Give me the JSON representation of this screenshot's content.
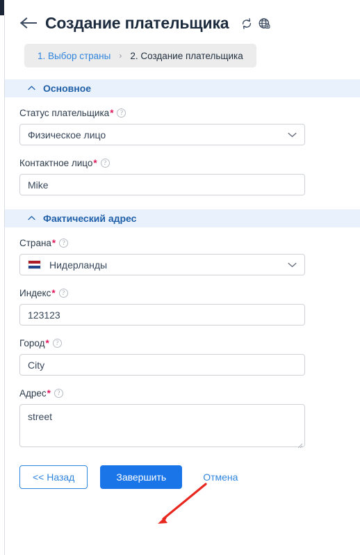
{
  "header": {
    "back_icon": "arrow-left-icon",
    "title": "Создание плательщика",
    "refresh_icon": "refresh-icon",
    "language_icon": "globe-icon"
  },
  "breadcrumb": {
    "steps": [
      {
        "label": "1. Выбор страны",
        "active": false
      },
      {
        "label": "2. Создание плательщика",
        "active": true
      }
    ],
    "separator": "›"
  },
  "sections": [
    {
      "title": "Основное",
      "caret_icon": "chevron-up-icon",
      "fields": [
        {
          "label": "Статус плательщика",
          "required": "*",
          "help": "?",
          "type": "select",
          "value": "Физическое лицо",
          "chevron_icon": "chevron-down-icon"
        },
        {
          "label": "Контактное лицо",
          "required": "*",
          "help": "?",
          "type": "text",
          "value": "Mike"
        }
      ]
    },
    {
      "title": "Фактический адрес",
      "caret_icon": "chevron-up-icon",
      "fields": [
        {
          "label": "Страна",
          "required": "*",
          "help": "?",
          "type": "select-flag",
          "value": "Нидерланды",
          "flag_icon": "flag-netherlands-icon",
          "chevron_icon": "chevron-down-icon"
        },
        {
          "label": "Индекс",
          "required": "*",
          "help": "?",
          "type": "text",
          "value": "123123"
        },
        {
          "label": "Город",
          "required": "*",
          "help": "?",
          "type": "text",
          "value": "City"
        },
        {
          "label": "Адрес",
          "required": "*",
          "help": "?",
          "type": "textarea",
          "value": "street"
        }
      ]
    }
  ],
  "footer": {
    "back_label": "<< Назад",
    "submit_label": "Завершить",
    "cancel_label": "Отмена"
  },
  "annotation": {
    "arrow_icon": "red-arrow-pointer",
    "color": "#e8281e"
  },
  "colors": {
    "accent": "#1a76e8",
    "link": "#2f84dd",
    "section_bg": "#e8f1fc",
    "section_text": "#1f5fa8",
    "required": "#e0145a",
    "breadcrumb_bg": "#ececec",
    "flag_red": "#ae1c28",
    "flag_white": "#ffffff",
    "flag_blue": "#21468b"
  }
}
